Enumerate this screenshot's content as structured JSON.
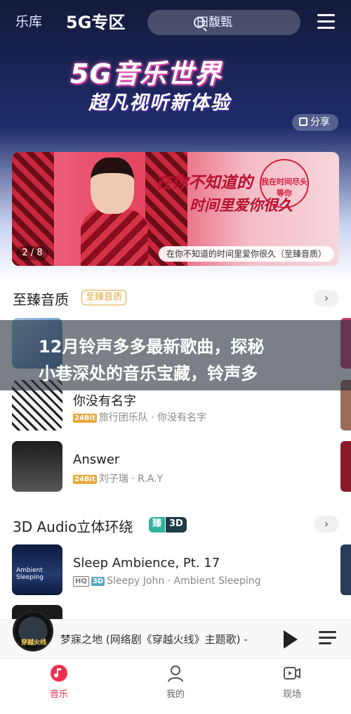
{
  "header": {
    "tab_library": "乐库",
    "tab_5g": "5G专区",
    "search_placeholder": "田馥甄"
  },
  "hero": {
    "title": "5G音乐世界",
    "subtitle": "超凡视听新体验",
    "share_label": "分享"
  },
  "banner": {
    "counter": "2 / 8",
    "caption": "在你不知道的时间里爱你很久（至臻音质）",
    "art_title_line1": "在你不知道的",
    "art_title_line2": "时间里爱你很久",
    "stamp_text": "我在时间尽头等你"
  },
  "section_quality": {
    "title": "至臻音质",
    "tag": "至臻音质",
    "more": "›",
    "songs": [
      {
        "title": "你没有名字",
        "badge": "24Bit",
        "meta": "旅行团乐队 · 你没有名字"
      },
      {
        "title": "Answer",
        "badge": "24Bit",
        "meta": "刘子瑞 · R.A.Y"
      }
    ]
  },
  "section_3d": {
    "title": "3D Audio立体环绕",
    "tag_left": "臻",
    "tag_right": "3D",
    "more": "›",
    "songs": [
      {
        "title": "Sleep Ambience, Pt. 17",
        "badge_hq": "HQ",
        "badge_3d": "3D",
        "meta": "Sleepy John · Ambient Sleeping",
        "thumb_text": "Ambient Sleeping"
      }
    ]
  },
  "overlay": {
    "line1": "12月铃声多多最新歌曲，探秘",
    "line2": "小巷深处的音乐宝藏，铃声多"
  },
  "player": {
    "now_playing": "梦寐之地 (网络剧《穿越火线》主题歌) -",
    "disc_label": "穿越火线"
  },
  "bottom_nav": {
    "items": [
      {
        "label": "音乐"
      },
      {
        "label": "我的"
      },
      {
        "label": "现场"
      }
    ]
  },
  "colors": {
    "accent": "#ef2f4f",
    "gold_tag": "#e2a73b",
    "green_tag": "#2fb39b"
  }
}
